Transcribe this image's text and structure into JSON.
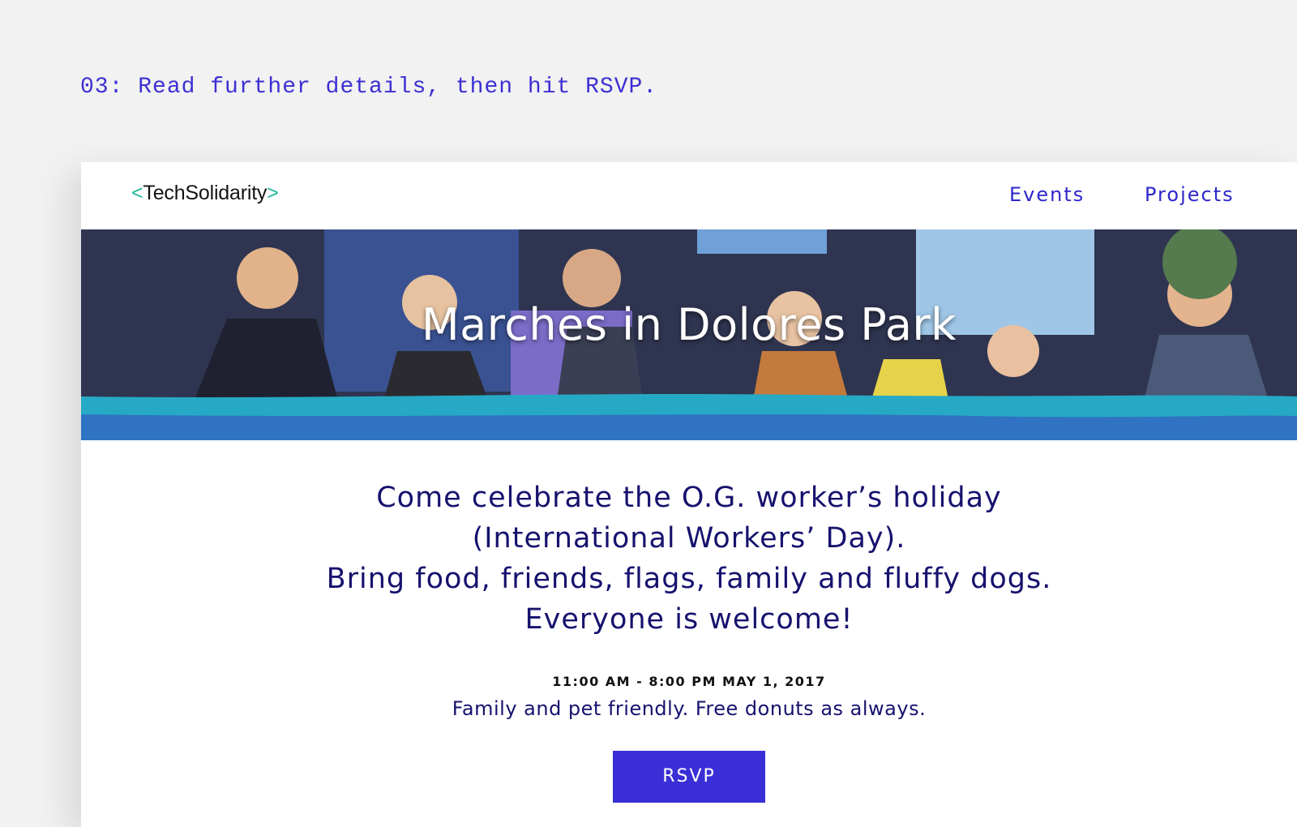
{
  "caption": "03: Read further details, then hit RSVP.",
  "logo": {
    "open_bracket": "<",
    "name": "TechSolidarity",
    "close_bracket": ">"
  },
  "nav": {
    "events": "Events",
    "projects": "Projects"
  },
  "hero": {
    "title": "Marches in Dolores Park"
  },
  "details": {
    "intro_lines": [
      "Come celebrate the O.G. worker’s holiday",
      "(International Workers’ Day).",
      "Bring food, friends, flags, family and fluffy dogs.",
      "Everyone is welcome!"
    ],
    "time": "11:00 AM - 8:00 PM MAY 1, 2017",
    "note": "Family and pet friendly. Free donuts as always."
  },
  "rsvp": {
    "label": "RSVP"
  },
  "colors": {
    "accent": "#3a2fd6",
    "navy": "#16126e",
    "logo_bracket": "#1cb89b",
    "background": "#f1f2f1"
  }
}
